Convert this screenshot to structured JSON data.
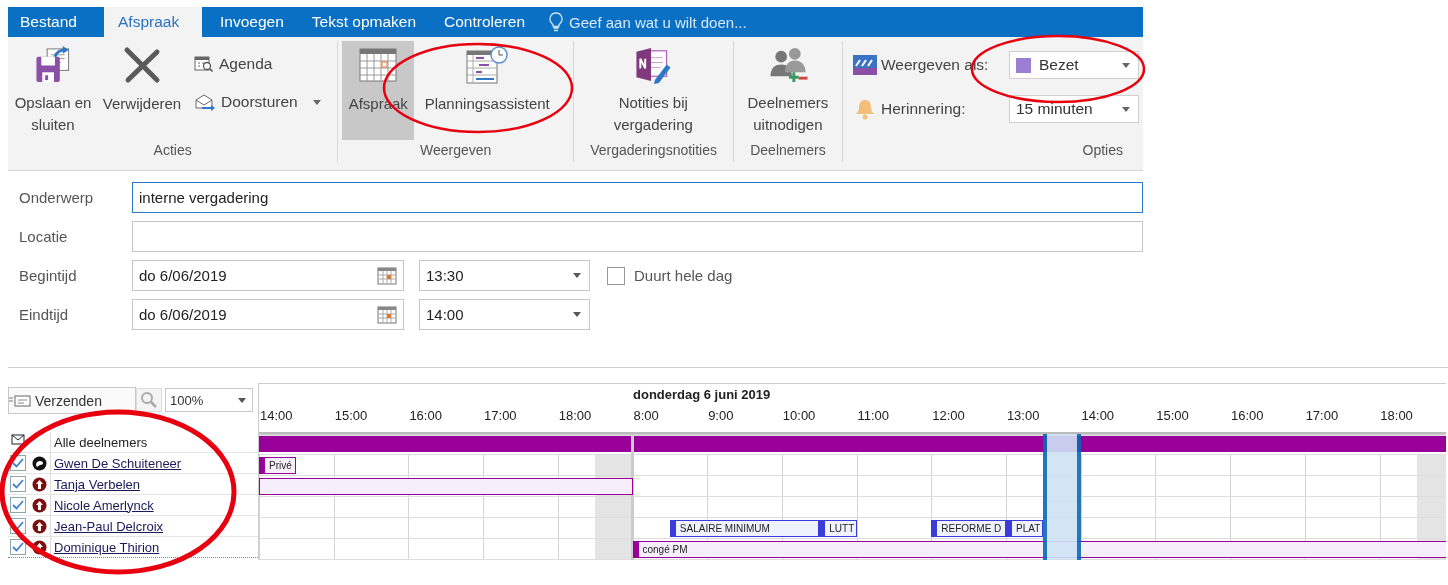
{
  "ribbon_tabs": [
    {
      "label": "Bestand",
      "selected": false
    },
    {
      "label": "Afspraak",
      "selected": true
    },
    {
      "label": "Invoegen",
      "selected": false
    },
    {
      "label": "Tekst opmaken",
      "selected": false
    },
    {
      "label": "Controleren",
      "selected": false
    }
  ],
  "tell_me": {
    "placeholder": "Geef aan wat u wilt doen..."
  },
  "ribbon": {
    "acties": {
      "label": "Acties",
      "save": "Opslaan en sluiten",
      "delete": "Verwijderen",
      "calendar": "Agenda",
      "forward": "Doorsturen"
    },
    "weergeven": {
      "label": "Weergeven",
      "views": [
        {
          "label": "Afspraak",
          "kind": "appointment",
          "selected": true
        },
        {
          "label": "Planningsassistent",
          "kind": "scheduling",
          "selected": false
        }
      ]
    },
    "notities": {
      "label": "Vergaderingsnotities",
      "button": "Notities bij vergadering"
    },
    "deelnemers": {
      "label": "Deelnemers",
      "button": "Deelnemers uitnodigen"
    },
    "opties": {
      "label": "Opties",
      "show_as_label": "Weergeven als:",
      "show_as_value": "Bezet",
      "reminder_label": "Herinnering:",
      "reminder_value": "15 minuten"
    }
  },
  "form": {
    "subject": {
      "label": "Onderwerp",
      "value": "interne vergadering"
    },
    "location": {
      "label": "Locatie"
    },
    "start": {
      "label": "Begintijd",
      "date": "do 6/06/2019",
      "time": "13:30"
    },
    "end": {
      "label": "Eindtijd",
      "date": "do 6/06/2019",
      "time": "14:00"
    },
    "all_day": {
      "label": "Duurt hele dag",
      "checked": false
    }
  },
  "scheduler": {
    "send_button": "Verzenden",
    "zoom": "100%",
    "date_title": "donderdag 6 juni 2019",
    "hours_previous_day": [
      "14:00",
      "15:00",
      "16:00",
      "17:00",
      "18:00"
    ],
    "hours_meeting_day": [
      "8:00",
      "9:00",
      "10:00",
      "11:00",
      "12:00",
      "13:00",
      "14:00",
      "15:00",
      "16:00",
      "17:00",
      "18:00"
    ],
    "all_attendees": "Alle deelnemers",
    "attendees": [
      {
        "name": "Gwen De Schuiteneer",
        "kind": "organizer",
        "checked": true,
        "busy": [
          {
            "kind": "away",
            "label": "Privé",
            "starts_in_view": true
          }
        ]
      },
      {
        "name": "Tanja Verbelen",
        "kind": "required",
        "checked": true,
        "busy": [
          {
            "kind": "away",
            "starts_in_view": false
          }
        ]
      },
      {
        "name": "Nicole Amerlynck",
        "kind": "required",
        "checked": true
      },
      {
        "name": "Jean-Paul Delcroix",
        "kind": "required",
        "checked": true,
        "busy": [
          {
            "kind": "busy",
            "label": "SALAIRE MINIMUM",
            "starts_in_view": true
          },
          {
            "kind": "busy",
            "label": "LUTT",
            "starts_in_view": true
          },
          {
            "kind": "busy",
            "label": "REFORME D",
            "starts_in_view": true
          },
          {
            "kind": "busy",
            "label": "PLAT",
            "starts_in_view": true
          }
        ]
      },
      {
        "name": "Dominique Thirion",
        "kind": "required",
        "checked": true,
        "busy": [
          {
            "kind": "away",
            "label": "congé PM",
            "starts_in_view": true
          }
        ]
      }
    ]
  }
}
